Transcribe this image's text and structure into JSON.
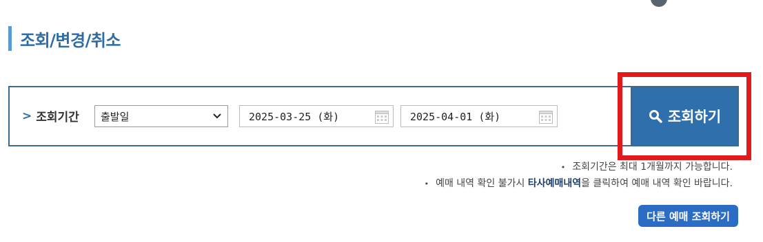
{
  "page": {
    "title": "조회/변경/취소"
  },
  "search": {
    "period_label": "조회기간",
    "date_type_selected": "출발일",
    "start_date": "2025-03-25 (화)",
    "end_date": "2025-04-01 (화)",
    "button_label": "조회하기"
  },
  "notes": {
    "line1": "조회기간은 최대 1개월까지 가능합니다.",
    "line2_before": "예매 내역 확인 불가시 ",
    "line2_link": "타사예매내역",
    "line2_after": "을 클릭하여 예매 내역 확인 바랍니다."
  },
  "other_button": {
    "label": "다른 예매 조회하기"
  },
  "colors": {
    "accent": "#2f6fac",
    "title": "#2e6da4",
    "highlight": "#e01a1a"
  }
}
